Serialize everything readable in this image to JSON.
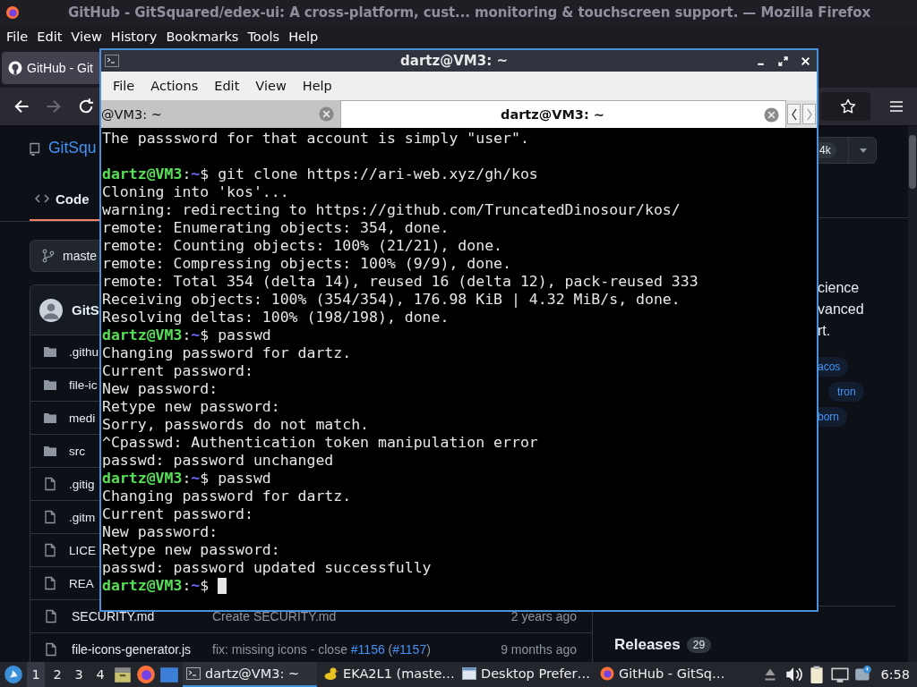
{
  "browser": {
    "title": "GitHub - GitSquared/edex-ui: A cross-platform, cust... monitoring & touchscreen support. — Mozilla Firefox",
    "menu": [
      "File",
      "Edit",
      "View",
      "History",
      "Bookmarks",
      "Tools",
      "Help"
    ],
    "tab": {
      "title": "GitHub - Git",
      "selected": true
    },
    "forward_disabled": true
  },
  "github": {
    "repo_link": "GitSqu",
    "code_tab": {
      "label": "Code",
      "selected": true
    },
    "branch": "maste",
    "commit_author": "GitS",
    "files": [
      {
        "kind": "folder",
        "name": ".githu"
      },
      {
        "kind": "folder",
        "name": "file-ic"
      },
      {
        "kind": "folder",
        "name": "medi"
      },
      {
        "kind": "folder",
        "name": "src"
      },
      {
        "kind": "file",
        "name": ".gitig"
      },
      {
        "kind": "file",
        "name": ".gitm"
      },
      {
        "kind": "file",
        "name": "LICE"
      },
      {
        "kind": "file",
        "name": "REA"
      }
    ],
    "bottom_files": [
      {
        "kind": "file",
        "name": "SECURITY.md",
        "message": [
          {
            "kind": "text",
            "text": "Create SECURITY.md"
          }
        ],
        "age": "2 years ago"
      },
      {
        "kind": "file",
        "name": "file-icons-generator.js",
        "message": [
          {
            "kind": "text",
            "text": "fix: missing icons - close "
          },
          {
            "kind": "link",
            "text": "#1156"
          },
          {
            "kind": "text",
            "text": " ("
          },
          {
            "kind": "link",
            "text": "#1157"
          },
          {
            "kind": "text",
            "text": ")"
          }
        ],
        "age": "9 months ago"
      }
    ],
    "star_count": "4k",
    "about_lines": [
      "cience",
      "vanced",
      "rt."
    ],
    "topics": [
      "acos",
      "tron",
      "born"
    ],
    "releases": {
      "label": "Releases",
      "count": "29"
    }
  },
  "terminal": {
    "title": "dartz@VM3: ~",
    "menu": [
      "File",
      "Actions",
      "Edit",
      "View",
      "Help"
    ],
    "tabs": [
      {
        "title": "@VM3: ~",
        "selected": false
      },
      {
        "title": "dartz@VM3: ~",
        "selected": true
      }
    ],
    "cursor": true,
    "lines": [
      {
        "kind": "output",
        "text": "The passsword for that account is simply \"user\"."
      },
      {
        "kind": "blank"
      },
      {
        "kind": "prompt",
        "user": "dartz@VM3",
        "sep": ":",
        "path": "~",
        "command": "$ git clone https://ari-web.xyz/gh/kos"
      },
      {
        "kind": "output",
        "text": "Cloning into 'kos'..."
      },
      {
        "kind": "output",
        "text": "warning: redirecting to https://github.com/TruncatedDinosour/kos/"
      },
      {
        "kind": "output",
        "text": "remote: Enumerating objects: 354, done."
      },
      {
        "kind": "output",
        "text": "remote: Counting objects: 100% (21/21), done."
      },
      {
        "kind": "output",
        "text": "remote: Compressing objects: 100% (9/9), done."
      },
      {
        "kind": "output",
        "text": "remote: Total 354 (delta 14), reused 16 (delta 12), pack-reused 333"
      },
      {
        "kind": "output",
        "text": "Receiving objects: 100% (354/354), 176.98 KiB | 4.32 MiB/s, done."
      },
      {
        "kind": "output",
        "text": "Resolving deltas: 100% (198/198), done."
      },
      {
        "kind": "prompt",
        "user": "dartz@VM3",
        "sep": ":",
        "path": "~",
        "command": "$ passwd"
      },
      {
        "kind": "output",
        "text": "Changing password for dartz."
      },
      {
        "kind": "output",
        "text": "Current password:"
      },
      {
        "kind": "output",
        "text": "New password:"
      },
      {
        "kind": "output",
        "text": "Retype new password:"
      },
      {
        "kind": "output",
        "text": "Sorry, passwords do not match."
      },
      {
        "kind": "output",
        "text": "^Cpasswd: Authentication token manipulation error"
      },
      {
        "kind": "output",
        "text": "passwd: password unchanged"
      },
      {
        "kind": "prompt",
        "user": "dartz@VM3",
        "sep": ":",
        "path": "~",
        "command": "$ passwd"
      },
      {
        "kind": "output",
        "text": "Changing password for dartz."
      },
      {
        "kind": "output",
        "text": "Current password:"
      },
      {
        "kind": "output",
        "text": "New password:"
      },
      {
        "kind": "output",
        "text": "Retype new password:"
      },
      {
        "kind": "output",
        "text": "passwd: password updated successfully"
      },
      {
        "kind": "prompt",
        "user": "dartz@VM3",
        "sep": ":",
        "path": "~",
        "command": "$"
      }
    ]
  },
  "taskbar": {
    "workspaces": [
      {
        "label": "1",
        "selected": true
      },
      {
        "label": "2",
        "selected": false
      },
      {
        "label": "3",
        "selected": false
      },
      {
        "label": "4",
        "selected": false
      }
    ],
    "windows": [
      {
        "kind": "terminal",
        "title": "dartz@VM3: ~",
        "selected": true
      },
      {
        "kind": "duck",
        "title": "EKA2L1 (maste…",
        "selected": false
      },
      {
        "kind": "window",
        "title": "Desktop Prefer…",
        "selected": false
      },
      {
        "kind": "firefox",
        "title": "GitHub - GitSq…",
        "selected": false
      }
    ],
    "clock": "6:58"
  }
}
